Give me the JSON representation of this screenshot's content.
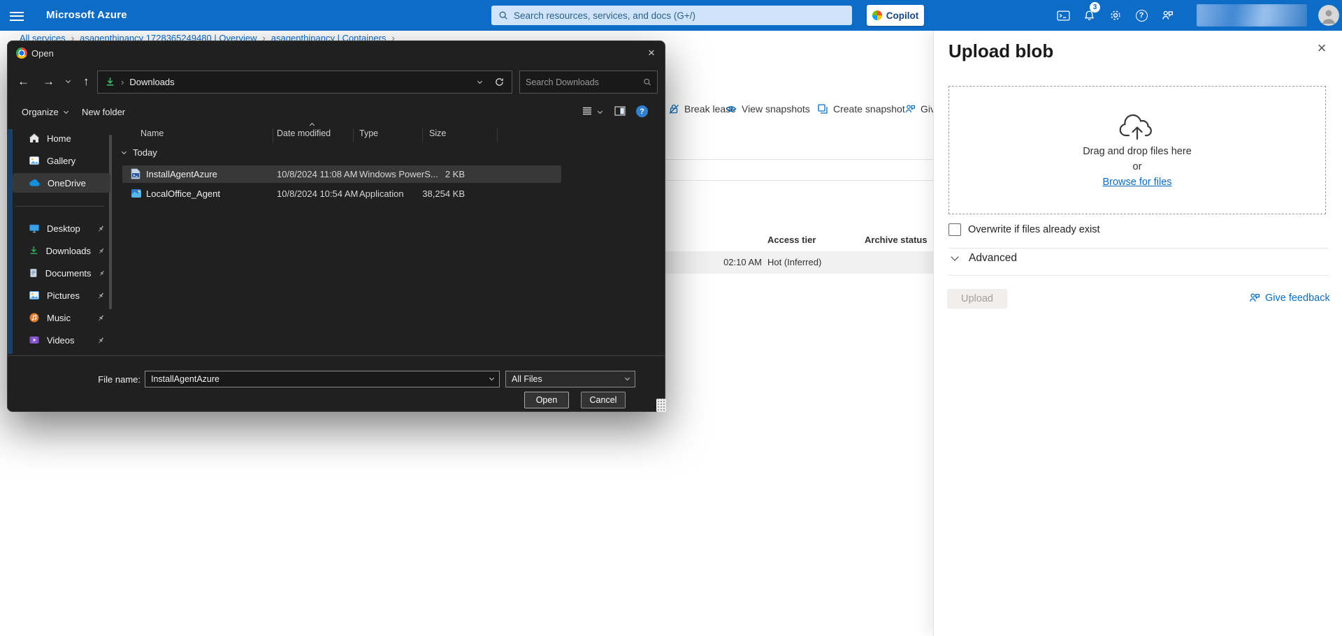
{
  "header": {
    "brand": "Microsoft Azure",
    "search_placeholder": "Search resources, services, and docs (G+/)",
    "copilot_label": "Copilot",
    "notification_badge": "3"
  },
  "breadcrumb": {
    "items": [
      "All services",
      "asagenthinancy 1728365249480 | Overview",
      "asagenthinancy | Containers"
    ]
  },
  "container_toolbar": {
    "items": [
      "Break lease",
      "View snapshots",
      "Create snapshot",
      "Giv"
    ]
  },
  "blob_list": {
    "access_tier_header": "Access tier",
    "archive_status_header": "Archive status",
    "row_modified_fragment": "02:10 AM",
    "row_access_tier": "Hot (Inferred)"
  },
  "upload_panel": {
    "title": "Upload blob",
    "dropzone_line1": "Drag and drop files here",
    "dropzone_line2": "or",
    "dropzone_link": "Browse for files",
    "overwrite_label": "Overwrite if files already exist",
    "advanced_label": "Advanced",
    "upload_button": "Upload",
    "feedback_link": "Give feedback"
  },
  "open_dialog": {
    "title": "Open",
    "address_location": "Downloads",
    "search_placeholder": "Search Downloads",
    "toolbar": {
      "organize": "Organize",
      "new_folder": "New folder"
    },
    "columns": {
      "name": "Name",
      "date_modified": "Date modified",
      "type": "Type",
      "size": "Size"
    },
    "group_label": "Today",
    "files": [
      {
        "name": "InstallAgentAzure",
        "modified": "10/8/2024 11:08 AM",
        "type": "Windows PowerS...",
        "size": "2 KB"
      },
      {
        "name": "LocalOffice_Agent",
        "modified": "10/8/2024 10:54 AM",
        "type": "Application",
        "size": "38,254 KB"
      }
    ],
    "sidebar": [
      {
        "label": "Home"
      },
      {
        "label": "Gallery"
      },
      {
        "label": "OneDrive"
      },
      {
        "label": "Desktop"
      },
      {
        "label": "Downloads"
      },
      {
        "label": "Documents"
      },
      {
        "label": "Pictures"
      },
      {
        "label": "Music"
      },
      {
        "label": "Videos"
      }
    ],
    "footer": {
      "file_name_label": "File name:",
      "file_name_value": "InstallAgentAzure",
      "file_type_value": "All Files",
      "open_button": "Open",
      "cancel_button": "Cancel"
    }
  },
  "glyphs": {
    "question": "?",
    "close": "×",
    "back": "←",
    "forward": "→",
    "up": "↑",
    "breadcrumb_sep": "›",
    "address_sep": "›"
  },
  "colors": {
    "header_blue": "#0d6cc6",
    "accent_blue": "#0a6cbe",
    "link_blue": "#0b6bcb",
    "dialog_bg": "#202020",
    "selected_row_dark": "#383838",
    "selected_row_light": "#f1f1f1"
  }
}
